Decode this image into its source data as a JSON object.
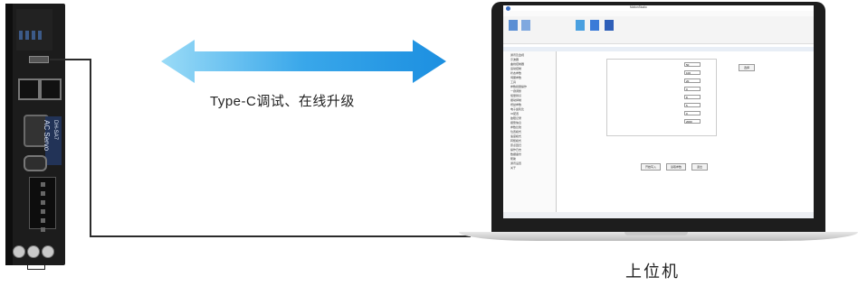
{
  "labels": {
    "typec": "Type-C调试、在线升级",
    "host_pc": "上位机"
  },
  "servo": {
    "brand_text": "AC Servo",
    "model_text": "DH-SA7"
  },
  "software": {
    "title": "MotionStudio",
    "tree_items": [
      "通讯及监视",
      "示波器",
      "曲线控制器",
      "运动控制",
      "状态参数",
      "伺服参数",
      "工具",
      "参数批量操作",
      "一键调整",
      "惯量辨识",
      "振动抑制",
      "增益参数",
      "电子齿轮比",
      "IO配置",
      "故障记录",
      "报警信息",
      "参数比较",
      "位置模式",
      "速度模式",
      "转矩模式",
      "原点回归",
      "操作日志",
      "数据备份",
      "帮助",
      "通讯设置",
      "关于"
    ],
    "fields": [
      "50",
      "100",
      "20",
      "0",
      "8",
      "5",
      "0",
      "2000"
    ],
    "buttons": [
      "选择",
      "开始写入",
      "读取参数",
      "退出"
    ]
  },
  "colors": {
    "arrow_light": "#7fd1f5",
    "arrow_dark": "#1c8fe0",
    "cable": "#2b2b2b"
  }
}
